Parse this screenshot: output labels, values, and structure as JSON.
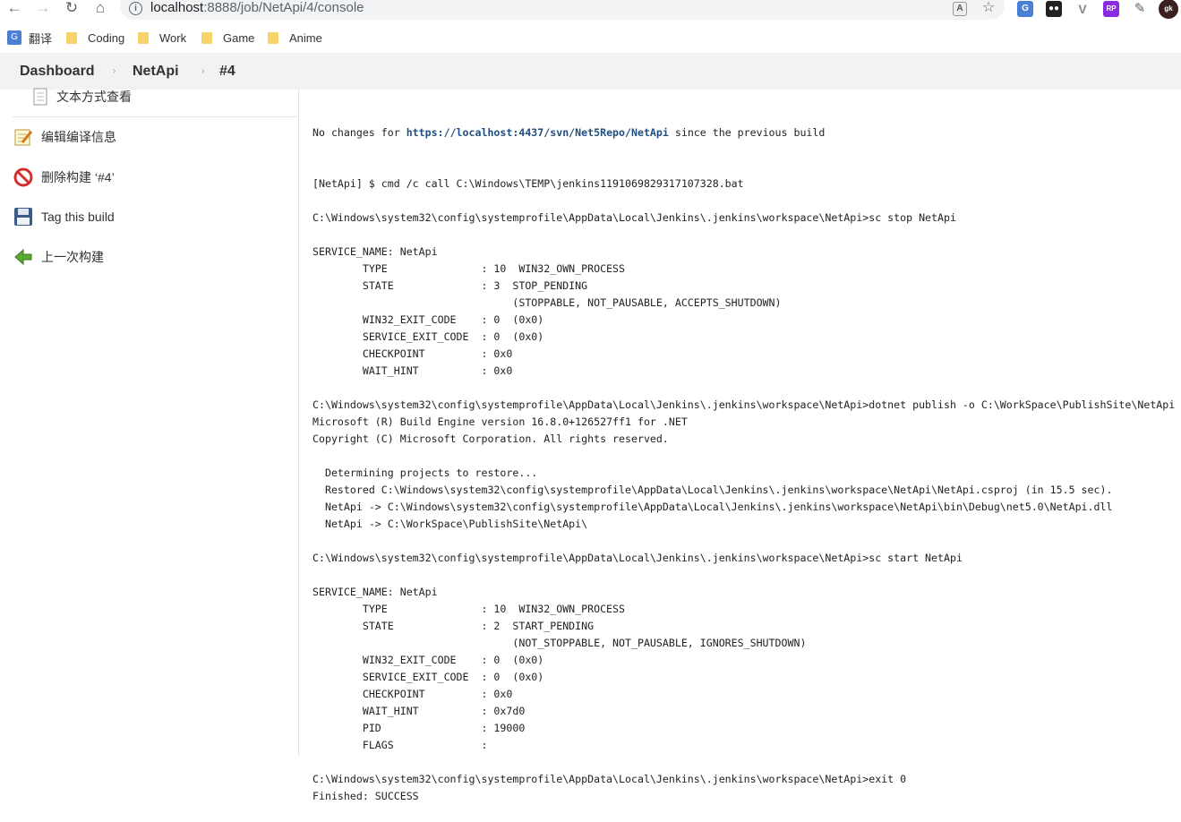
{
  "browser": {
    "url_host": "localhost",
    "url_path": ":8888/job/NetApi/4/console",
    "nav_icons": [
      "back-arrow-icon",
      "forward-arrow-icon",
      "reload-icon",
      "home-icon"
    ],
    "extensions": [
      "google-translate-icon",
      "tampermonkey-icon",
      "vue-devtools-icon",
      "axure-rp-icon",
      "puzzle-extensions-icon",
      "profile-avatar-icon"
    ]
  },
  "bookmarks": [
    {
      "label": "翻译",
      "icon": "google-translate-icon"
    },
    {
      "label": "Coding",
      "icon": "folder-icon"
    },
    {
      "label": "Work",
      "icon": "folder-icon"
    },
    {
      "label": "Game",
      "icon": "folder-icon"
    },
    {
      "label": "Anime",
      "icon": "folder-icon"
    }
  ],
  "breadcrumb": {
    "items": [
      "Dashboard",
      "NetApi",
      "#4"
    ],
    "separator": "›"
  },
  "sidebar": {
    "items": [
      {
        "label": "文本方式查看",
        "icon": "document-icon"
      },
      {
        "label": "编辑编译信息",
        "icon": "edit-notepad-icon"
      },
      {
        "label": "删除构建 ‘#4’",
        "icon": "no-entry-icon"
      },
      {
        "label": "Tag this build",
        "icon": "floppy-disk-icon"
      },
      {
        "label": "上一次构建",
        "icon": "green-left-arrow-icon"
      }
    ]
  },
  "console": {
    "link_text": "https://localhost:4437/svn/Net5Repo/NetApi",
    "first_line_prefix": "No changes for ",
    "first_line_suffix": " since the previous build",
    "lines": [
      "[NetApi] $ cmd /c call C:\\Windows\\TEMP\\jenkins1191069829317107328.bat",
      "",
      "C:\\Windows\\system32\\config\\systemprofile\\AppData\\Local\\Jenkins\\.jenkins\\workspace\\NetApi>sc stop NetApi",
      "",
      "SERVICE_NAME: NetApi",
      "        TYPE               : 10  WIN32_OWN_PROCESS",
      "        STATE              : 3  STOP_PENDING",
      "                                (STOPPABLE, NOT_PAUSABLE, ACCEPTS_SHUTDOWN)",
      "        WIN32_EXIT_CODE    : 0  (0x0)",
      "        SERVICE_EXIT_CODE  : 0  (0x0)",
      "        CHECKPOINT         : 0x0",
      "        WAIT_HINT          : 0x0",
      "",
      "C:\\Windows\\system32\\config\\systemprofile\\AppData\\Local\\Jenkins\\.jenkins\\workspace\\NetApi>dotnet publish -o C:\\WorkSpace\\PublishSite\\NetApi",
      "Microsoft (R) Build Engine version 16.8.0+126527ff1 for .NET",
      "Copyright (C) Microsoft Corporation. All rights reserved.",
      "",
      "  Determining projects to restore...",
      "  Restored C:\\Windows\\system32\\config\\systemprofile\\AppData\\Local\\Jenkins\\.jenkins\\workspace\\NetApi\\NetApi.csproj (in 15.5 sec).",
      "  NetApi -> C:\\Windows\\system32\\config\\systemprofile\\AppData\\Local\\Jenkins\\.jenkins\\workspace\\NetApi\\bin\\Debug\\net5.0\\NetApi.dll",
      "  NetApi -> C:\\WorkSpace\\PublishSite\\NetApi\\",
      "",
      "C:\\Windows\\system32\\config\\systemprofile\\AppData\\Local\\Jenkins\\.jenkins\\workspace\\NetApi>sc start NetApi",
      "",
      "SERVICE_NAME: NetApi",
      "        TYPE               : 10  WIN32_OWN_PROCESS",
      "        STATE              : 2  START_PENDING",
      "                                (NOT_STOPPABLE, NOT_PAUSABLE, IGNORES_SHUTDOWN)",
      "        WIN32_EXIT_CODE    : 0  (0x0)",
      "        SERVICE_EXIT_CODE  : 0  (0x0)",
      "        CHECKPOINT         : 0x0",
      "        WAIT_HINT          : 0x7d0",
      "        PID                : 19000",
      "        FLAGS              :",
      "",
      "C:\\Windows\\system32\\config\\systemprofile\\AppData\\Local\\Jenkins\\.jenkins\\workspace\\NetApi>exit 0",
      "Finished: SUCCESS"
    ]
  },
  "colors": {
    "breadcrumb_bg": "#f2f2f2",
    "link": "#1f4f82",
    "folder": "#f6d46a"
  }
}
